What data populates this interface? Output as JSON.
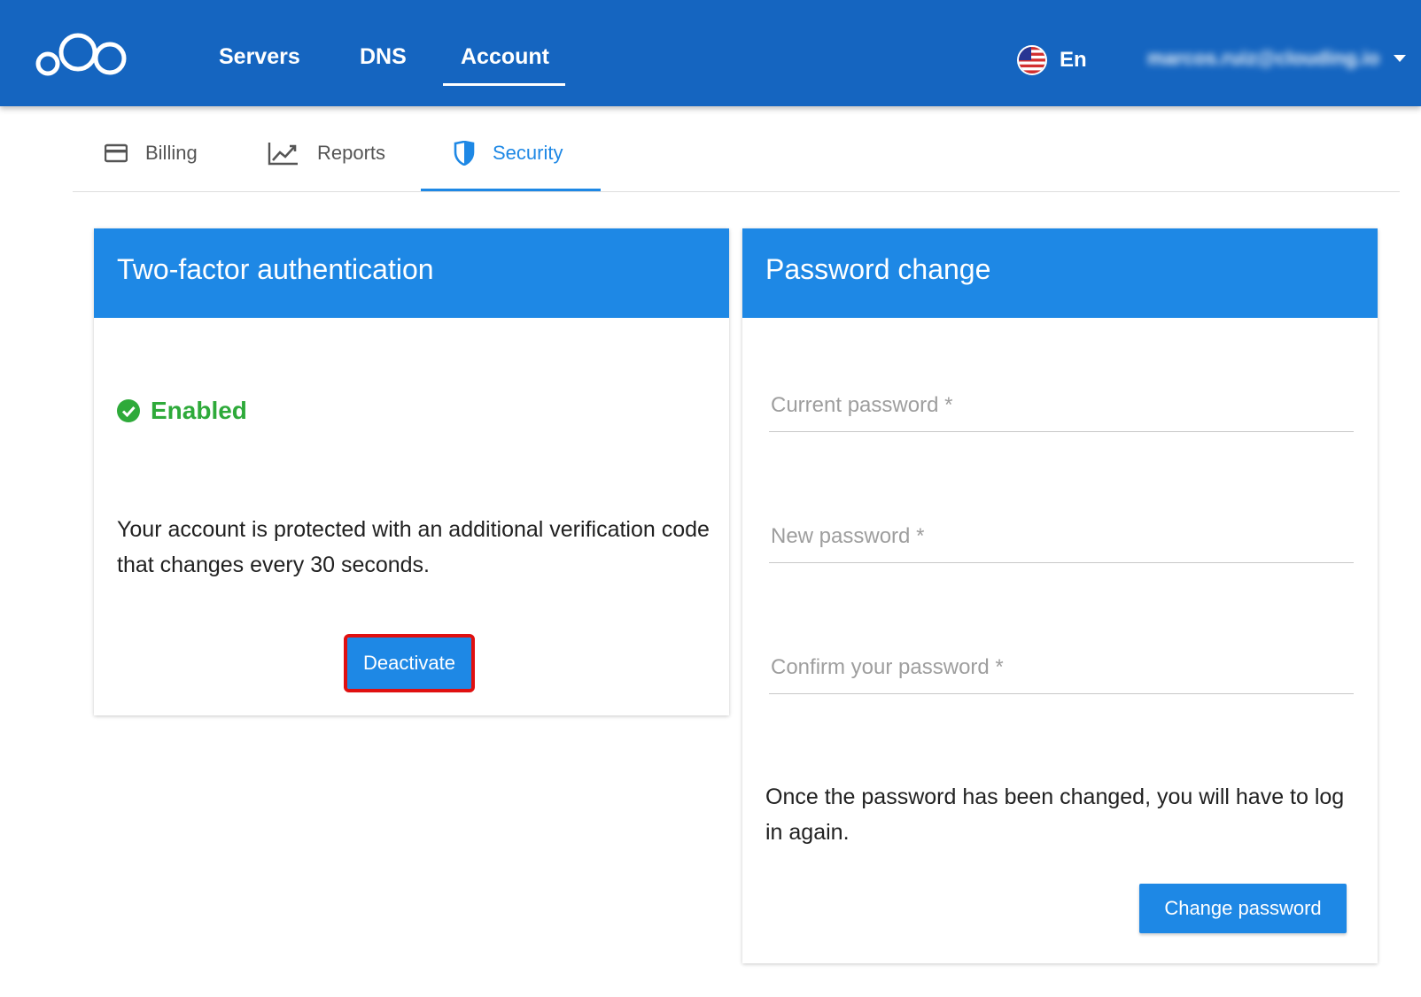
{
  "nav": {
    "items": [
      {
        "label": "Servers"
      },
      {
        "label": "DNS"
      },
      {
        "label": "Account"
      }
    ],
    "active": "Account",
    "language": "En",
    "user_email": "marcos.ruiz@clouding.io"
  },
  "tabs": [
    {
      "label": "Billing",
      "icon": "credit-card-icon"
    },
    {
      "label": "Reports",
      "icon": "trending-up-icon"
    },
    {
      "label": "Security",
      "icon": "shield-icon"
    }
  ],
  "active_tab": "Security",
  "two_factor": {
    "title": "Two-factor authentication",
    "status": "Enabled",
    "description": "Your account is protected with an additional verification code that changes every 30 seconds.",
    "button": "Deactivate"
  },
  "password_change": {
    "title": "Password change",
    "fields": {
      "current": {
        "placeholder": "Current password *",
        "value": ""
      },
      "new": {
        "placeholder": "New password *",
        "value": ""
      },
      "confirm": {
        "placeholder": "Confirm your password *",
        "value": ""
      }
    },
    "note": "Once the password has been changed, you will have to log in again.",
    "button": "Change password"
  },
  "colors": {
    "appbar": "#1565c0",
    "accent": "#1e88e5",
    "success": "#2eaa3a",
    "highlight": "#e01010"
  }
}
